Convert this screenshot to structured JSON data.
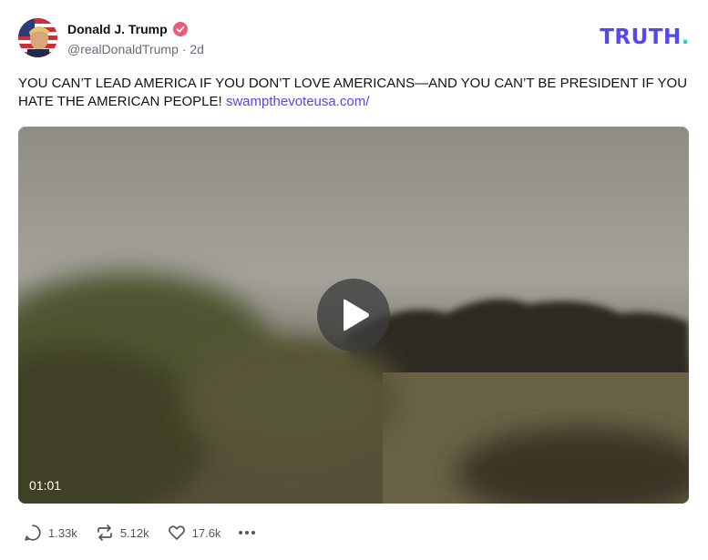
{
  "post": {
    "author": {
      "display_name": "Donald J. Trump",
      "handle": "@realDonaldTrump",
      "time_ago": "2d",
      "verified": true
    },
    "brand": {
      "name": "TRUTH",
      "dot": "."
    },
    "text": "YOU CAN’T LEAD AMERICA IF YOU DON’T LOVE AMERICANS—AND YOU CAN’T BE PRESIDENT IF YOU HATE THE AMERICAN PEOPLE!",
    "link_text": "swampthevoteusa.com/",
    "video": {
      "duration": "01:01"
    },
    "stats": {
      "replies": "1.33k",
      "retruths": "5.12k",
      "likes": "17.6k"
    }
  },
  "colors": {
    "brand": "#5448ee",
    "brand_dot": "#17d9c3",
    "verified": "#e95a7b"
  }
}
